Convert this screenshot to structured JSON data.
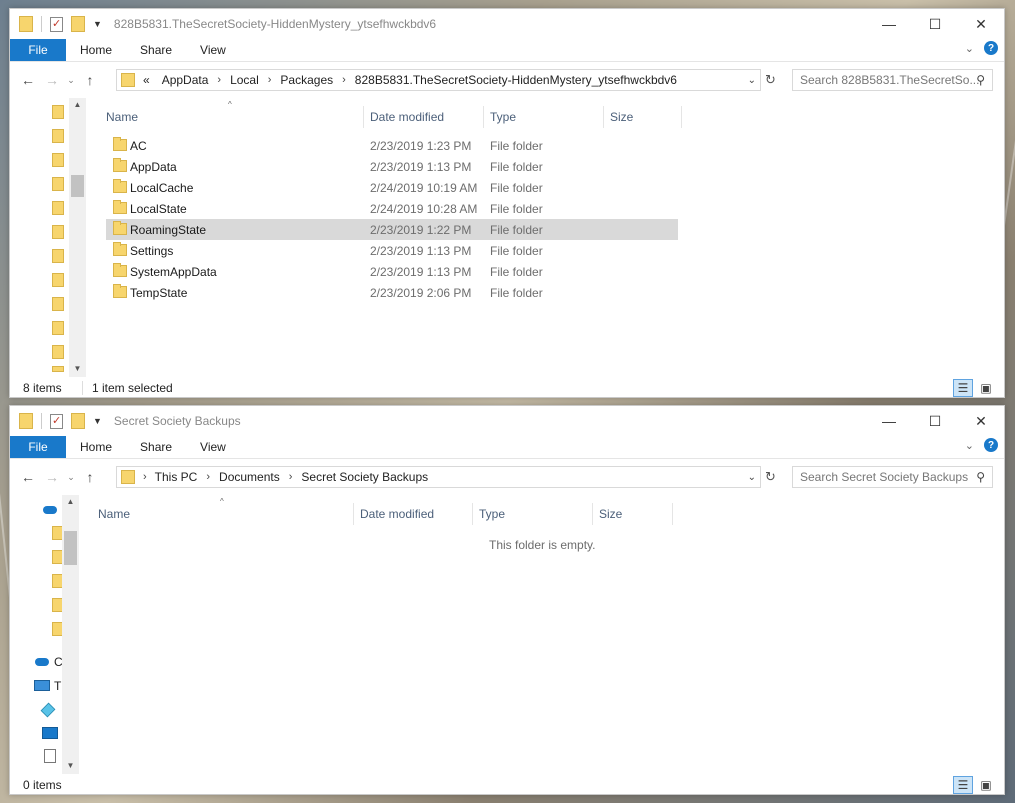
{
  "ribbon": {
    "file": "File",
    "tabs": [
      "Home",
      "Share",
      "View"
    ]
  },
  "columns": {
    "name": "Name",
    "date": "Date modified",
    "type": "Type",
    "size": "Size"
  },
  "top_window": {
    "title": "828B5831.TheSecretSociety-HiddenMystery_ytsefhwckbdv6",
    "address": {
      "overflow": "«",
      "crumbs": [
        "AppData",
        "Local",
        "Packages",
        "828B5831.TheSecretSociety-HiddenMystery_ytsefhwckbdv6"
      ]
    },
    "search_placeholder": "Search 828B5831.TheSecretSo...",
    "files": [
      {
        "name": "AC",
        "date": "2/23/2019 1:23 PM",
        "type": "File folder",
        "selected": false
      },
      {
        "name": "AppData",
        "date": "2/23/2019 1:13 PM",
        "type": "File folder",
        "selected": false
      },
      {
        "name": "LocalCache",
        "date": "2/24/2019 10:19 AM",
        "type": "File folder",
        "selected": false
      },
      {
        "name": "LocalState",
        "date": "2/24/2019 10:28 AM",
        "type": "File folder",
        "selected": false
      },
      {
        "name": "RoamingState",
        "date": "2/23/2019 1:22 PM",
        "type": "File folder",
        "selected": true
      },
      {
        "name": "Settings",
        "date": "2/23/2019 1:13 PM",
        "type": "File folder",
        "selected": false
      },
      {
        "name": "SystemAppData",
        "date": "2/23/2019 1:13 PM",
        "type": "File folder",
        "selected": false
      },
      {
        "name": "TempState",
        "date": "2/23/2019 2:06 PM",
        "type": "File folder",
        "selected": false
      }
    ],
    "status_count": "8 items",
    "status_selected": "1 item selected"
  },
  "bottom_window": {
    "title": "Secret Society Backups",
    "address": {
      "crumbs": [
        "This PC",
        "Documents",
        "Secret Society Backups"
      ]
    },
    "search_placeholder": "Search Secret Society Backups",
    "empty_message": "This folder is empty.",
    "sidebar_letters": [
      "C",
      "T"
    ],
    "status_count": "0 items"
  },
  "colors": {
    "accent": "#1979ca",
    "folder": "#f7d56d",
    "selection": "#d9d9d9"
  }
}
